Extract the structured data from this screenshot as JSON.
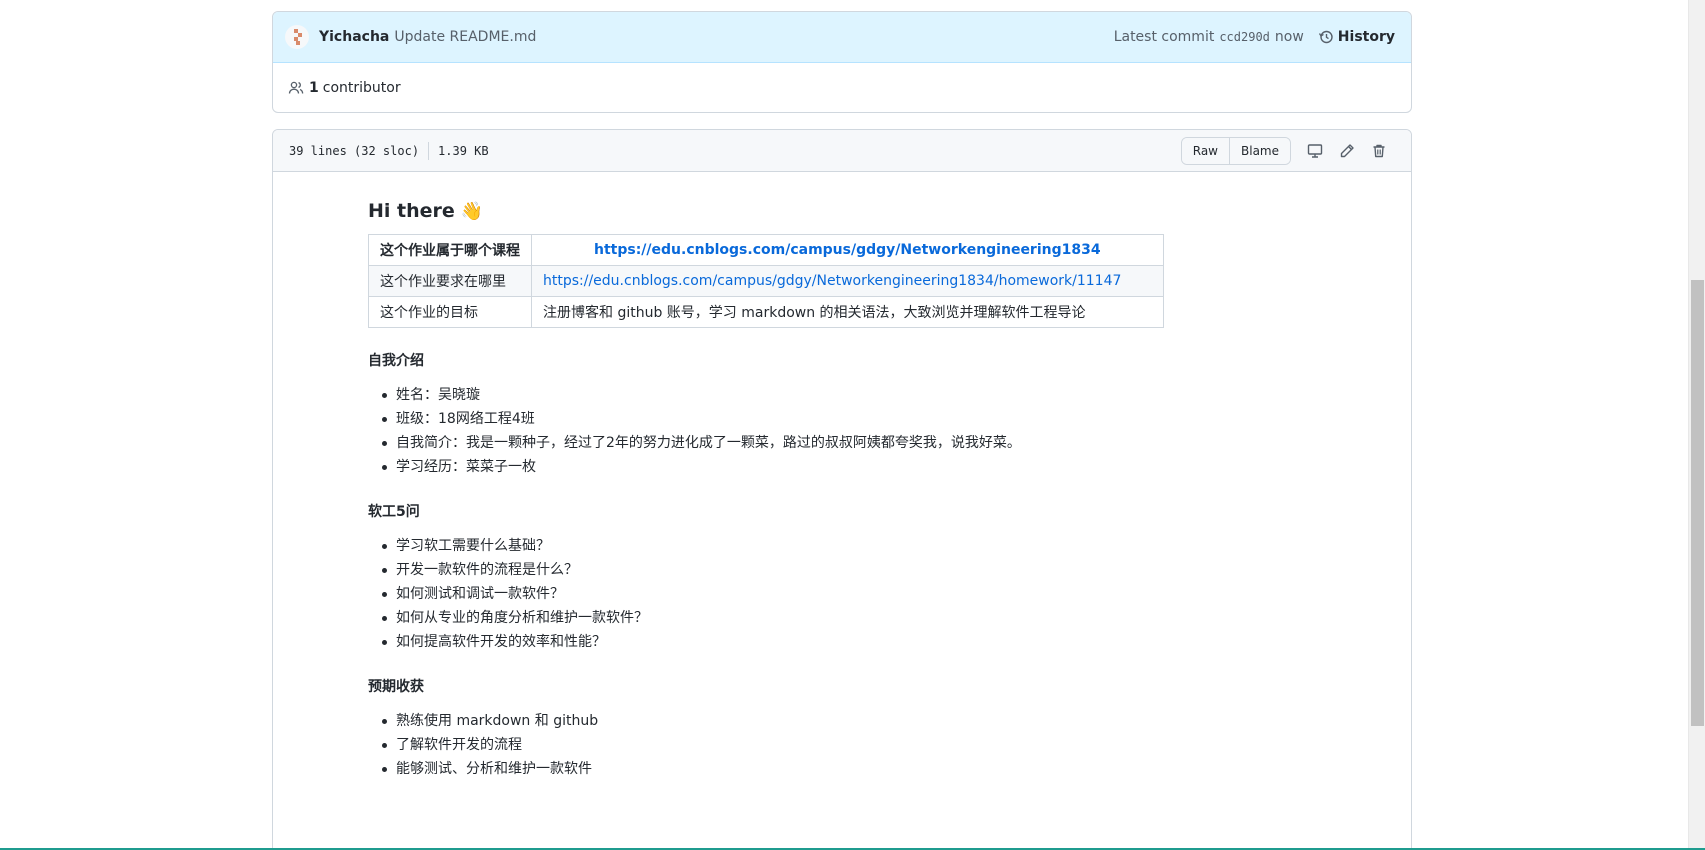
{
  "commit": {
    "author": "Yichacha",
    "message": "Update README.md",
    "latest_label": "Latest commit",
    "sha": "ccd290d",
    "time": "now",
    "history_label": "History",
    "contributor_count": "1",
    "contributor_label": "contributor"
  },
  "file": {
    "lines": "39 lines (32 sloc)",
    "size": "1.39 KB",
    "raw_label": "Raw",
    "blame_label": "Blame"
  },
  "readme": {
    "heading": "Hi there",
    "wave_emoji": "👋",
    "table": [
      {
        "label": "这个作业属于哪个课程",
        "value": "https://edu.cnblogs.com/campus/gdgy/Networkengineering1834"
      },
      {
        "label": "这个作业要求在哪里",
        "value": "https://edu.cnblogs.com/campus/gdgy/Networkengineering1834/homework/11147"
      },
      {
        "label": "这个作业的目标",
        "value": "注册博客和 github 账号，学习 markdown 的相关语法，大致浏览并理解软件工程导论"
      }
    ],
    "section1": {
      "title": "自我介绍",
      "items": [
        "姓名：吴晓璇",
        "班级：18网络工程4班",
        "自我简介：我是一颗种子，经过了2年的努力进化成了一颗菜，路过的叔叔阿姨都夸奖我，说我好菜。",
        "学习经历：菜菜子一枚"
      ]
    },
    "section2": {
      "title": "软工5问",
      "items": [
        "学习软工需要什么基础？",
        "开发一款软件的流程是什么？",
        "如何测试和调试一款软件？",
        "如何从专业的角度分析和维护一款软件？",
        "如何提高软件开发的效率和性能？"
      ]
    },
    "section3": {
      "title": "预期收获",
      "items": [
        "熟练使用 markdown 和 github",
        "了解软件开发的流程",
        "能够测试、分析和维护一款软件"
      ]
    }
  },
  "colors": {
    "link": "#0969da",
    "commit_bg": "#ddf4ff",
    "header_bg": "#f6f8fa"
  }
}
